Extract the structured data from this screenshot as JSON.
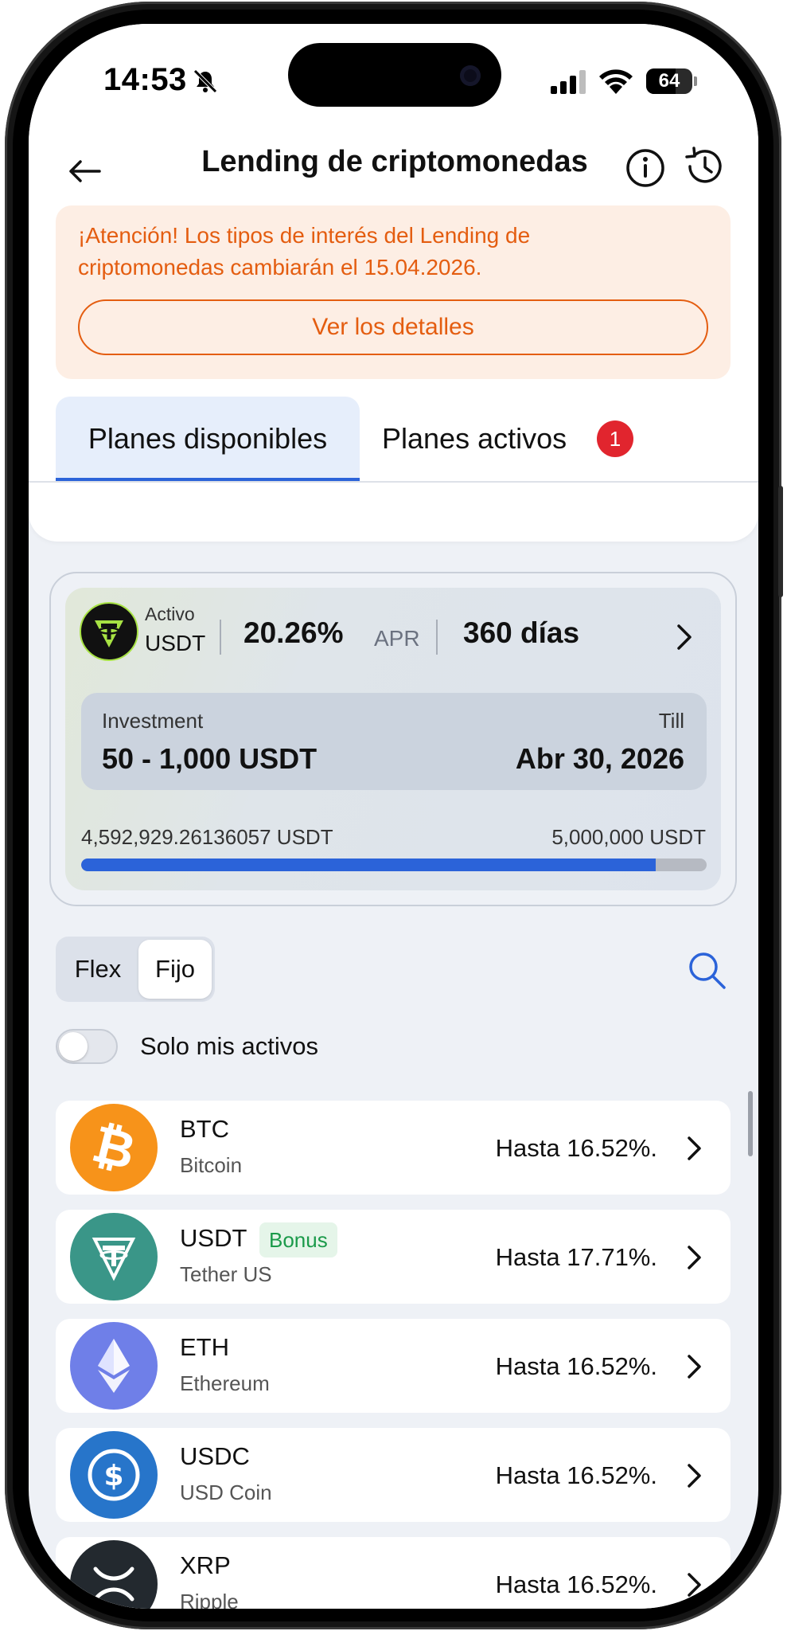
{
  "status_bar": {
    "time": "14:53",
    "battery": "64",
    "battery_level_fraction": 0.64
  },
  "header": {
    "title": "Lending de criptomonedas",
    "back_icon": "arrow-left-icon",
    "info_icon": "info-icon",
    "history_icon": "history-icon"
  },
  "notice": {
    "text": "¡Atención! Los tipos de interés del Lending de criptomonedas cambiarán el 15.04.2026.",
    "button_label": "Ver los detalles",
    "color": "#e45d10",
    "background": "#fdeee4"
  },
  "tabs": {
    "active_label": "Planes disponibles",
    "inactive_label": "Planes activos",
    "inactive_badge": "1"
  },
  "featured_plan": {
    "asset_tag": "Activo",
    "asset": "USDT",
    "apr_value": "20.26%",
    "apr_label": "APR",
    "duration": "360 días",
    "investment_label": "Investment",
    "investment_value": "50 - 1,000 USDT",
    "till_label": "Till",
    "till_value": "Abr 30, 2026",
    "progress_current": "4,592,929.26136057 USDT",
    "progress_total": "5,000,000 USDT",
    "progress_fraction": 0.9186
  },
  "filters": {
    "segment_flex": "Flex",
    "segment_fijo": "Fijo",
    "selected_segment": "Fijo",
    "toggle_label": "Solo mis activos",
    "toggle_on": false
  },
  "assets": [
    {
      "symbol": "BTC",
      "name": "Bitcoin",
      "rate": "Hasta 16.52%.",
      "color": "#f7931a",
      "icon": "bitcoin-icon"
    },
    {
      "symbol": "USDT",
      "name": "Tether US",
      "rate": "Hasta 17.71%.",
      "badge": "Bonus",
      "color": "#3a9688",
      "icon": "tether-icon"
    },
    {
      "symbol": "ETH",
      "name": "Ethereum",
      "rate": "Hasta 16.52%.",
      "color": "#6f7fe8",
      "icon": "ethereum-icon"
    },
    {
      "symbol": "USDC",
      "name": "USD Coin",
      "rate": "Hasta 16.52%.",
      "color": "#2775ca",
      "icon": "usdc-icon"
    },
    {
      "symbol": "XRP",
      "name": "Ripple",
      "rate": "Hasta 16.52%.",
      "color": "#23292f",
      "icon": "xrp-icon"
    }
  ]
}
